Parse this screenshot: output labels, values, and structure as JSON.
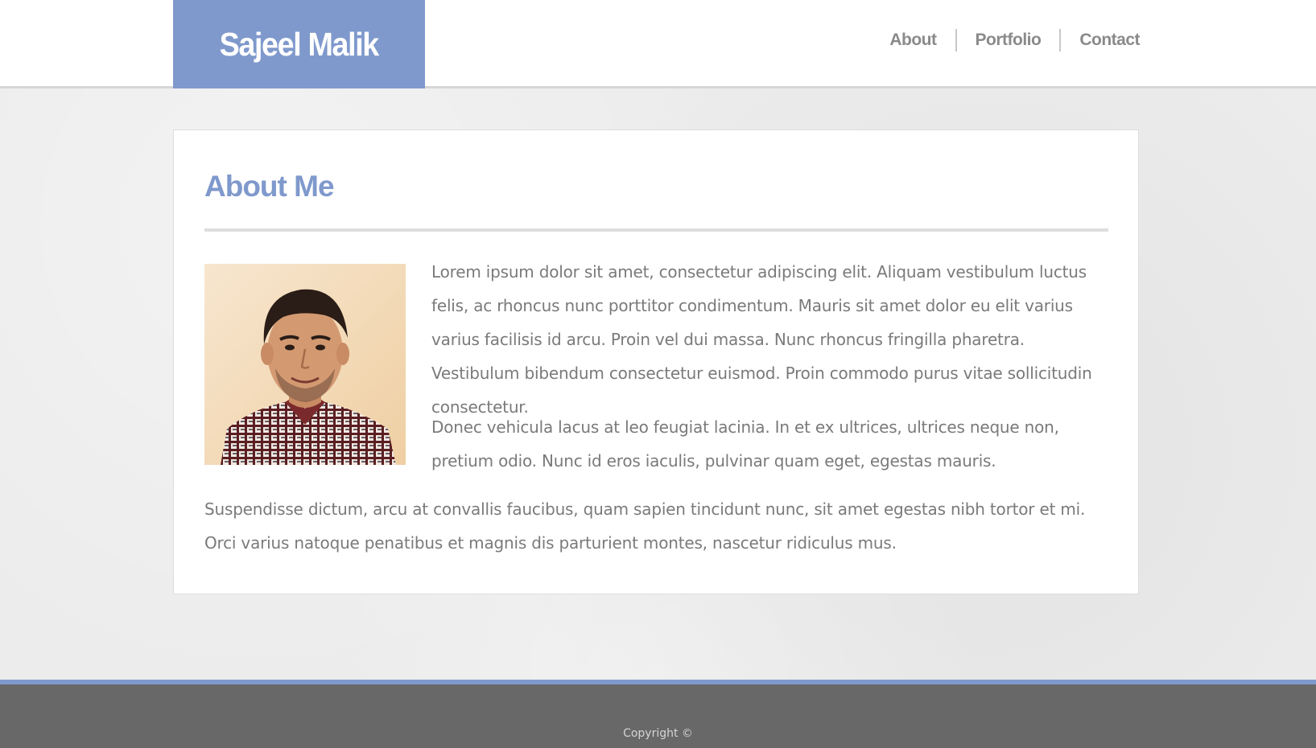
{
  "header": {
    "brand_name": "Sajeel Malik",
    "nav": [
      {
        "label": "About"
      },
      {
        "label": "Portfolio"
      },
      {
        "label": "Contact"
      }
    ]
  },
  "main": {
    "title": "About Me",
    "portrait_alt": "Portrait photo",
    "paragraphs": [
      "Lorem ipsum dolor sit amet, consectetur adipiscing elit. Aliquam vestibulum luctus felis, ac rhoncus nunc porttitor condimentum. Mauris sit amet dolor eu elit varius varius facilisis id arcu. Proin vel dui massa. Nunc rhoncus fringilla pharetra. Vestibulum bibendum consectetur euismod. Proin commodo purus vitae sollicitudin consectetur.",
      "Donec vehicula lacus at leo feugiat lacinia. In et ex ultrices, ultrices neque non, pretium odio. Nunc id eros iaculis, pulvinar quam eget, egestas mauris.",
      "Suspendisse dictum, arcu at convallis faucibus, quam sapien tincidunt nunc, sit amet egestas nibh tortor et mi. Orci varius natoque penatibus et magnis dis parturient montes, nascetur ridiculus mus."
    ]
  },
  "footer": {
    "copyright": "Copyright ©"
  },
  "colors": {
    "accent": "#7f99cc",
    "footer_bg": "#686868",
    "text": "#7a7a7a",
    "nav_text": "#8a8a8a"
  }
}
